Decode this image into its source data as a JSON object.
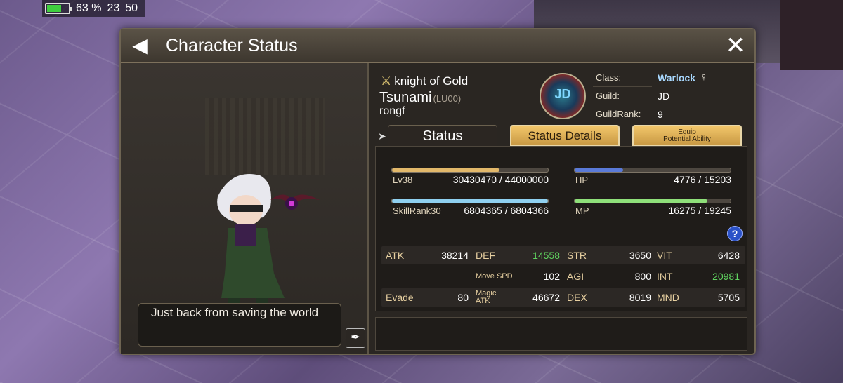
{
  "statusbar": {
    "battery": "63 %",
    "battery_level": 0.63,
    "signal": "23",
    "fps": "50"
  },
  "window": {
    "title": "Character Status"
  },
  "character": {
    "title_badge": "knight of Gold",
    "name": "Tsunami",
    "level_tag": "(LU00)",
    "account": "rongf",
    "motto": "Just back from saving the world"
  },
  "info": {
    "class_label": "Class:",
    "class_value": "Warlock",
    "gender": "♀",
    "guild_label": "Guild:",
    "guild_value": "JD",
    "guildrank_label": "GuildRank:",
    "guildrank_value": "9",
    "emblem_text": "JD"
  },
  "tabs": {
    "status": "Status",
    "details": "Status Details",
    "equip_line1": "Equip",
    "equip_line2": "Potential Ability"
  },
  "bars": {
    "lv": {
      "label": "Lv38",
      "value": "30430470 / 44000000",
      "fraction": 0.69,
      "color": "#e2b86a"
    },
    "hp": {
      "label": "HP",
      "value": "4776 / 15203",
      "fraction": 0.31,
      "color": "#5a7ad8"
    },
    "skill": {
      "label": "SkillRank30",
      "value": "6804365 / 6804366",
      "fraction": 1.0,
      "color": "#8fd0f0"
    },
    "mp": {
      "label": "MP",
      "value": "16275 / 19245",
      "fraction": 0.85,
      "color": "#8fe07a"
    }
  },
  "stats": {
    "atk_label": "ATK",
    "atk": "38214",
    "def_label": "DEF",
    "def": "14558",
    "str_label": "STR",
    "str": "3650",
    "vit_label": "VIT",
    "vit": "6428",
    "movespd_label": "Move SPD",
    "movespd": "102",
    "agi_label": "AGI",
    "agi": "800",
    "int_label": "INT",
    "int": "20981",
    "evade_label": "Evade",
    "evade": "80",
    "matk_label_1": "Magic",
    "matk_label_2": "ATK",
    "matk": "46672",
    "dex_label": "DEX",
    "dex": "8019",
    "mnd_label": "MND",
    "mnd": "5705"
  },
  "help_label": "?"
}
